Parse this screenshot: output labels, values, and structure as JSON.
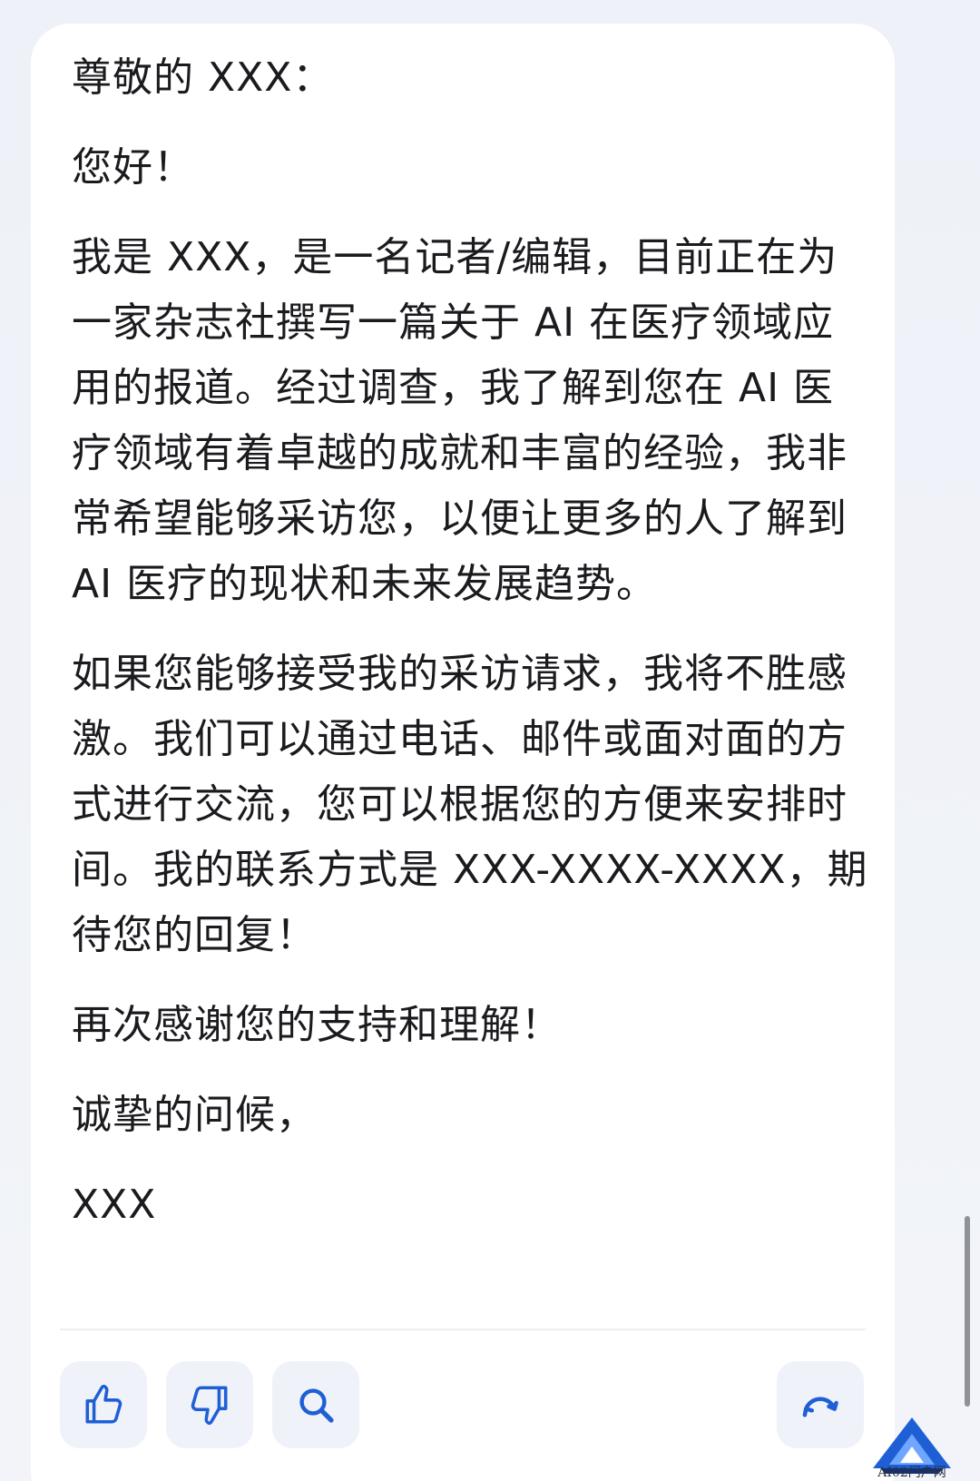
{
  "message": {
    "paragraphs": [
      "尊敬的 XXX：",
      "您好！",
      "我是 XXX，是一名记者/编辑，目前正在为一家杂志社撰写一篇关于 AI 在医疗领域应用的报道。经过调查，我了解到您在 AI 医疗领域有着卓越的成就和丰富的经验，我非常希望能够采访您，以便让更多的人了解到 AI 医疗的现状和未来发展趋势。",
      "如果您能够接受我的采访请求，我将不胜感激。我们可以通过电话、邮件或面对面的方式进行交流，您可以根据您的方便来安排时间。我的联系方式是 XXX-XXXX-XXXX，期待您的回复！",
      "再次感谢您的支持和理解！",
      "诚挚的问候，",
      "XXX"
    ]
  },
  "actions": [
    {
      "icon": "thumbs-up-icon"
    },
    {
      "icon": "thumbs-down-icon"
    },
    {
      "icon": "search-icon"
    },
    {
      "icon": "refresh-icon"
    }
  ],
  "watermark": {
    "text": "AI02门户网"
  },
  "colors": {
    "accent": "#1f5fd6",
    "text": "#1b1b1f",
    "button_bg": "#eff2f9"
  }
}
